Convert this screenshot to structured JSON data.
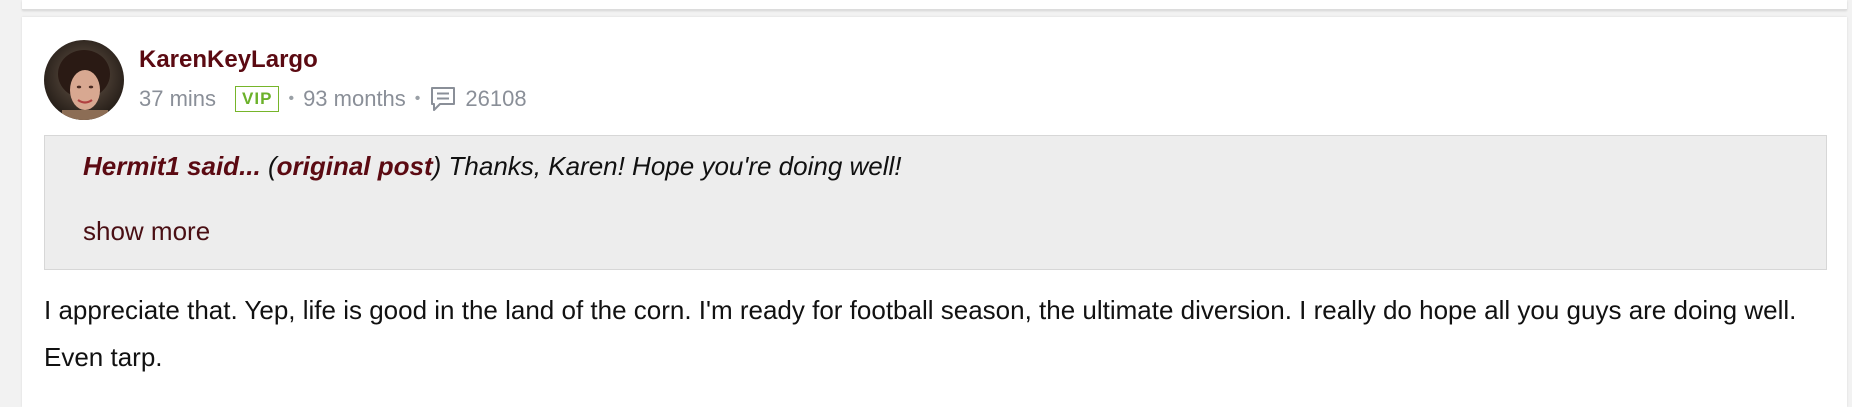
{
  "comment": {
    "username": "KarenKeyLargo",
    "time_ago": "37 mins",
    "badge": "VIP",
    "separator": "•",
    "member_duration": "93 months",
    "post_count": "26108",
    "quote": {
      "author": "Hermit1 said...",
      "open_paren": "(",
      "origin_link": "original post",
      "text": ") Thanks, Karen! Hope you're doing well!",
      "show_more": "show more"
    },
    "body": "I appreciate that. Yep, life is good in the land of the corn. I'm ready for football season, the ultimate diversion. I really do hope all you guys are doing well. Even tarp."
  },
  "icons": {
    "avatar": "user-avatar-photo",
    "posts": "speech-bubble-icon"
  },
  "colors": {
    "username": "#5b0a12",
    "vip": "#6bb12a",
    "meta": "#8a8f98",
    "quote_bg": "#ededed"
  }
}
